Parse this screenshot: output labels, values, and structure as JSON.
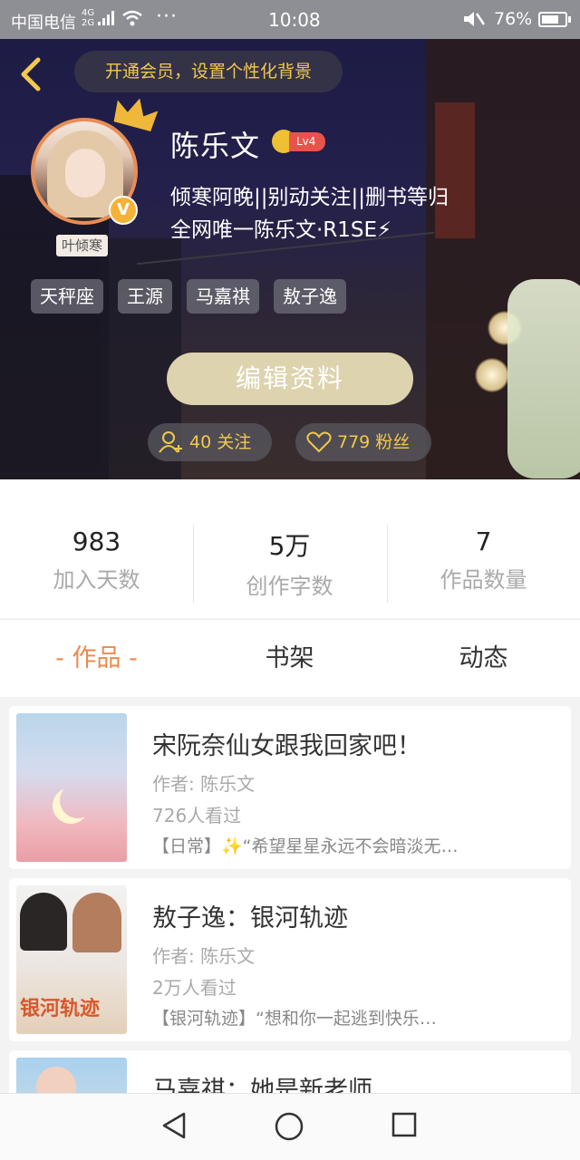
{
  "status_bar": {
    "carrier": "中国电信",
    "network_top": "4G",
    "network_bottom": "2G",
    "overflow": "···",
    "time": "10:08",
    "battery_text": "76%",
    "battery_level": 0.76
  },
  "header": {
    "vip_prompt": "开通会员，设置个性化背景",
    "username": "陈乐文",
    "level_badge": "Lv4",
    "verified_badge": "V",
    "avatar_caption": "叶倾寒",
    "bio_line1": "倾寒阿晚||别动关注||删书等归",
    "bio_line2": "全网唯一陈乐文·R1SE⚡",
    "tags": [
      "天秤座",
      "王源",
      "马嘉祺",
      "敖子逸"
    ],
    "edit_profile": "编辑资料",
    "following": "40 关注",
    "fans": "779 粉丝"
  },
  "stats": [
    {
      "value": "983",
      "label": "加入天数"
    },
    {
      "value": "5万",
      "label": "创作字数"
    },
    {
      "value": "7",
      "label": "作品数量"
    }
  ],
  "tabs": [
    "- 作品 -",
    "书架",
    "动态"
  ],
  "books": [
    {
      "title": "宋阮奈仙女跟我回家吧！",
      "author": "作者: 陈乐文",
      "views": "726人看过",
      "desc": "【日常】✨“希望星星永远不会暗淡无…"
    },
    {
      "title": "敖子逸：银河轨迹",
      "author": "作者: 陈乐文",
      "views": "2万人看过",
      "desc": "【银河轨迹】“想和你一起逃到快乐…",
      "cover_text": "银河轨迹"
    },
    {
      "title": "马嘉祺：她是新老师",
      "author": "",
      "views": "",
      "desc": ""
    }
  ],
  "colors": {
    "accent": "#e9894e",
    "gold": "#f2c94c",
    "edit_button": "#ddd3ae"
  }
}
